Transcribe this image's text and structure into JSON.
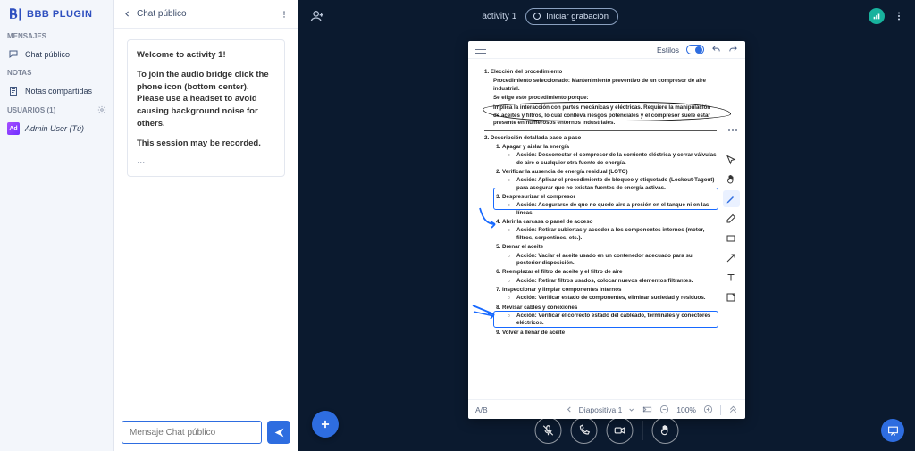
{
  "app": {
    "logo_text": "BBB PLUGIN"
  },
  "rail": {
    "messages_label": "MENSAJES",
    "public_chat_label": "Chat público",
    "notes_label": "NOTAS",
    "shared_notes_label": "Notas compartidas",
    "users_label": "USUARIOS (1)",
    "user_display": "Admin User (Tú)",
    "user_initials": "Ad"
  },
  "chat": {
    "title": "Chat público",
    "welcome": "Welcome to activity 1!",
    "audio_notice": "To join the audio bridge click the phone icon (bottom center). Please use a headset to avoid causing background noise for others.",
    "recorded_notice": "This session may be recorded.",
    "dots": "…",
    "placeholder": "Mensaje Chat público"
  },
  "topbar": {
    "activity": "activity 1",
    "record_label": "Iniciar grabación"
  },
  "slide": {
    "styles_label": "Estilos",
    "footer_left": "A/B",
    "slide_label": "Diapositiva 1",
    "zoom": "100%"
  },
  "doc": {
    "s1_title": "1.  Elección del procedimiento",
    "s1_sub": "Procedimiento seleccionado: Mantenimiento preventivo de un compresor de aire industrial.",
    "s1_why": "Se elige este procedimiento porque:",
    "s1_box": "Implica la interacción con partes mecánicas y eléctricas. Requiere la manipulación de aceites y filtros, lo cual conlleva riesgos potenciales y el compresor suele estar presente en numerosos entornos industriales.",
    "s2_title": "2.  Descripción detallada paso a paso",
    "steps": [
      {
        "t": "Apagar y aislar la energía",
        "a": "Acción: Desconectar el compresor de la corriente eléctrica y cerrar válvulas de aire o cualquier otra fuente de energía."
      },
      {
        "t": "Verificar la ausencia de energía residual (LOTO)",
        "a": "Acción: Aplicar el procedimiento de bloqueo y etiquetado (Lockout-Tagout) para asegurar que no existan fuentes de energía activas."
      },
      {
        "t": "Despresurizar el compresor",
        "a": "Acción: Asegurarse de que no quede aire a presión en el tanque ni en las líneas."
      },
      {
        "t": "Abrir la carcasa o panel de acceso",
        "a": "Acción: Retirar cubiertas y acceder a los componentes internos (motor, filtros, serpentines, etc.)."
      },
      {
        "t": "Drenar el aceite",
        "a": "Acción: Vaciar el aceite usado en un contenedor adecuado para su posterior disposición."
      },
      {
        "t": "Reemplazar el filtro de aceite y el filtro de aire",
        "a": "Acción: Retirar filtros usados, colocar nuevos elementos filtrantes."
      },
      {
        "t": "Inspeccionar y limpiar componentes internos",
        "a": "Acción: Verificar estado de componentes, eliminar suciedad y residuos."
      },
      {
        "t": "Revisar cables y conexiones",
        "a": "Acción: Verificar el correcto estado del cableado, terminales y conectores eléctricos."
      },
      {
        "t": "Volver a llenar de aceite",
        "a": ""
      }
    ]
  }
}
